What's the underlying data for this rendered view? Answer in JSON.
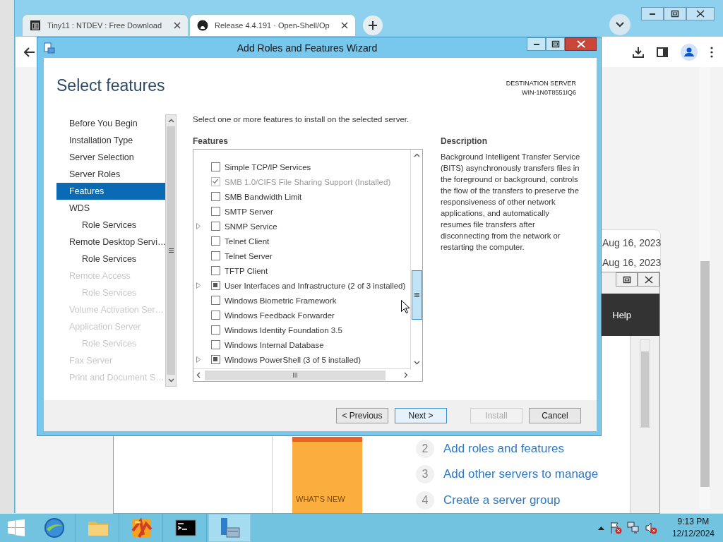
{
  "browser": {
    "tabs": [
      {
        "title": "Tiny11 : NTDEV : Free Download",
        "kind": "library",
        "selected": false
      },
      {
        "title": "Release 4.4.191 · Open-Shell/Op",
        "kind": "cat",
        "selected": true
      }
    ],
    "page": {
      "dates": [
        "Aug 16, 2023",
        "Aug 16, 2023"
      ]
    }
  },
  "server_manager": {
    "toolbar": {
      "help": "Help"
    },
    "tile": {
      "label": "WHAT'S NEW"
    },
    "steps": [
      {
        "number": "2",
        "label": "Add roles and features"
      },
      {
        "number": "3",
        "label": "Add other servers to manage"
      },
      {
        "number": "4",
        "label": "Create a server group"
      }
    ]
  },
  "wizard": {
    "title": "Add Roles and Features Wizard",
    "heading": "Select features",
    "destination": {
      "label": "DESTINATION SERVER",
      "server": "WIN-1N0T8551IQ6"
    },
    "nav": [
      {
        "label": "Before You Begin",
        "selected": false,
        "disabled": false
      },
      {
        "label": "Installation Type",
        "selected": false,
        "disabled": false
      },
      {
        "label": "Server Selection",
        "selected": false,
        "disabled": false
      },
      {
        "label": "Server Roles",
        "selected": false,
        "disabled": false
      },
      {
        "label": "Features",
        "selected": true,
        "disabled": false
      },
      {
        "label": "WDS",
        "selected": false,
        "disabled": false,
        "children": [
          {
            "label": "Role Services",
            "selected": false,
            "disabled": false
          }
        ]
      },
      {
        "label": "Remote Desktop Servi…",
        "selected": false,
        "disabled": false,
        "children": [
          {
            "label": "Role Services",
            "selected": false,
            "disabled": false
          }
        ]
      },
      {
        "label": "Remote Access",
        "selected": false,
        "disabled": true,
        "children": [
          {
            "label": "Role Services",
            "selected": false,
            "disabled": true
          }
        ]
      },
      {
        "label": "Volume Activation Ser…",
        "selected": false,
        "disabled": true
      },
      {
        "label": "Application Server",
        "selected": false,
        "disabled": true,
        "children": [
          {
            "label": "Role Services",
            "selected": false,
            "disabled": true
          }
        ]
      },
      {
        "label": "Fax Server",
        "selected": false,
        "disabled": true
      },
      {
        "label": "Print and Document S…",
        "selected": false,
        "disabled": true
      }
    ],
    "intro": "Select one or more features to install on the selected server.",
    "features_heading": "Features",
    "features": [
      {
        "label": "Simple TCP/IP Services",
        "checked": false,
        "partial": false,
        "disabled": false,
        "expandable": false
      },
      {
        "label": "SMB 1.0/CIFS File Sharing Support (Installed)",
        "checked": true,
        "partial": false,
        "disabled": true,
        "expandable": false
      },
      {
        "label": "SMB Bandwidth Limit",
        "checked": false,
        "partial": false,
        "disabled": false,
        "expandable": false
      },
      {
        "label": "SMTP Server",
        "checked": false,
        "partial": false,
        "disabled": false,
        "expandable": false
      },
      {
        "label": "SNMP Service",
        "checked": false,
        "partial": false,
        "disabled": false,
        "expandable": true
      },
      {
        "label": "Telnet Client",
        "checked": false,
        "partial": false,
        "disabled": false,
        "expandable": false
      },
      {
        "label": "Telnet Server",
        "checked": false,
        "partial": false,
        "disabled": false,
        "expandable": false
      },
      {
        "label": "TFTP Client",
        "checked": false,
        "partial": false,
        "disabled": false,
        "expandable": false
      },
      {
        "label": "User Interfaces and Infrastructure (2 of 3 installed)",
        "checked": false,
        "partial": true,
        "disabled": false,
        "expandable": true
      },
      {
        "label": "Windows Biometric Framework",
        "checked": false,
        "partial": false,
        "disabled": false,
        "expandable": false
      },
      {
        "label": "Windows Feedback Forwarder",
        "checked": false,
        "partial": false,
        "disabled": false,
        "expandable": false
      },
      {
        "label": "Windows Identity Foundation 3.5",
        "checked": false,
        "partial": false,
        "disabled": false,
        "expandable": false
      },
      {
        "label": "Windows Internal Database",
        "checked": false,
        "partial": false,
        "disabled": false,
        "expandable": false
      },
      {
        "label": "Windows PowerShell (3 of 5 installed)",
        "checked": false,
        "partial": true,
        "disabled": false,
        "expandable": true
      }
    ],
    "description_heading": "Description",
    "description": "Background Intelligent Transfer Service (BITS) asynchronously transfers files in the foreground or background, controls the flow of the transfers to preserve the responsiveness of other network applications, and automatically resumes file transfers after disconnecting from the network or restarting the computer.",
    "buttons": [
      {
        "label": "< Previous",
        "disabled": false,
        "default": false
      },
      {
        "label": "Next >",
        "disabled": false,
        "default": true
      },
      {
        "label": "Install",
        "disabled": true,
        "default": false
      },
      {
        "label": "Cancel",
        "disabled": false,
        "default": false
      }
    ]
  },
  "taskbar": {
    "apps": [
      {
        "kind": "globe",
        "selected": false
      },
      {
        "kind": "folder",
        "selected": false
      },
      {
        "kind": "colorful",
        "selected": false
      },
      {
        "kind": "terminal",
        "selected": false
      },
      {
        "kind": "server",
        "selected": true
      }
    ],
    "clock": {
      "time": "9:13 PM",
      "date": "12/12/2024"
    }
  }
}
